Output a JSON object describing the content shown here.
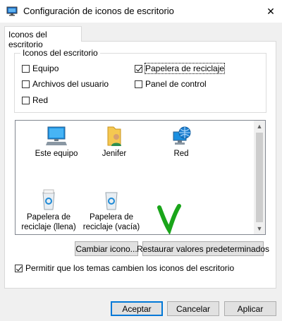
{
  "window": {
    "title": "Configuración de iconos de escritorio"
  },
  "tab": {
    "label": "Iconos del escritorio"
  },
  "group": {
    "legend": "Iconos del escritorio",
    "checkboxes": [
      {
        "label": "Equipo",
        "checked": false
      },
      {
        "label": "Papelera de reciclaje",
        "checked": true
      },
      {
        "label": "Archivos del usuario",
        "checked": false
      },
      {
        "label": "Panel de control",
        "checked": false
      },
      {
        "label": "Red",
        "checked": false
      }
    ]
  },
  "icons": [
    {
      "label": "Este equipo",
      "icon": "computer-icon"
    },
    {
      "label": "Jenifer",
      "icon": "user-folder-icon"
    },
    {
      "label": "Red",
      "icon": "network-icon"
    },
    {
      "label": "Papelera de reciclaje (llena)",
      "icon": "recycle-bin-full-icon"
    },
    {
      "label": "Papelera de reciclaje (vacía)",
      "icon": "recycle-bin-empty-icon"
    }
  ],
  "buttons": {
    "change_icon": "Cambiar icono...",
    "restore": "Restaurar valores predeterminados",
    "ok": "Aceptar",
    "cancel": "Cancelar",
    "apply": "Aplicar"
  },
  "allow_themes": {
    "label": "Permitir que los temas cambien los iconos del escritorio",
    "checked": true
  },
  "colors": {
    "accent": "#0078d7",
    "annotation": "#1aa51a"
  }
}
